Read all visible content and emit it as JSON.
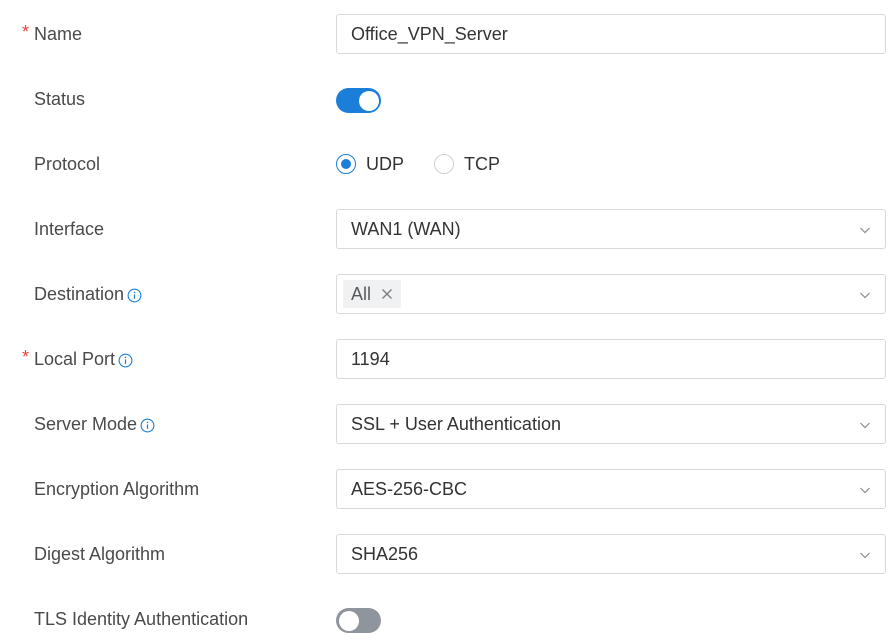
{
  "form": {
    "name": {
      "label": "Name",
      "required": "*",
      "value": "Office_VPN_Server"
    },
    "status": {
      "label": "Status",
      "enabled": true
    },
    "protocol": {
      "label": "Protocol",
      "options": [
        "UDP",
        "TCP"
      ],
      "selected": "UDP"
    },
    "interface": {
      "label": "Interface",
      "value": "WAN1 (WAN)"
    },
    "destination": {
      "label": "Destination",
      "tag": "All"
    },
    "local_port": {
      "label": "Local Port",
      "required": "*",
      "value": "1194"
    },
    "server_mode": {
      "label": "Server Mode",
      "value": "SSL + User Authentication"
    },
    "encryption_algorithm": {
      "label": "Encryption Algorithm",
      "value": "AES-256-CBC"
    },
    "digest_algorithm": {
      "label": "Digest Algorithm",
      "value": "SHA256"
    },
    "tls_identity_authentication": {
      "label": "TLS Identity Authentication",
      "enabled": false
    }
  },
  "colors": {
    "accent": "#1b7fd9",
    "required": "#e8463a",
    "toggle_off": "#8f959c",
    "border": "#d9d9d9"
  },
  "icons": {
    "info": "info-circle-icon",
    "dropdown": "chevron-down-icon",
    "remove_tag": "close-icon"
  }
}
